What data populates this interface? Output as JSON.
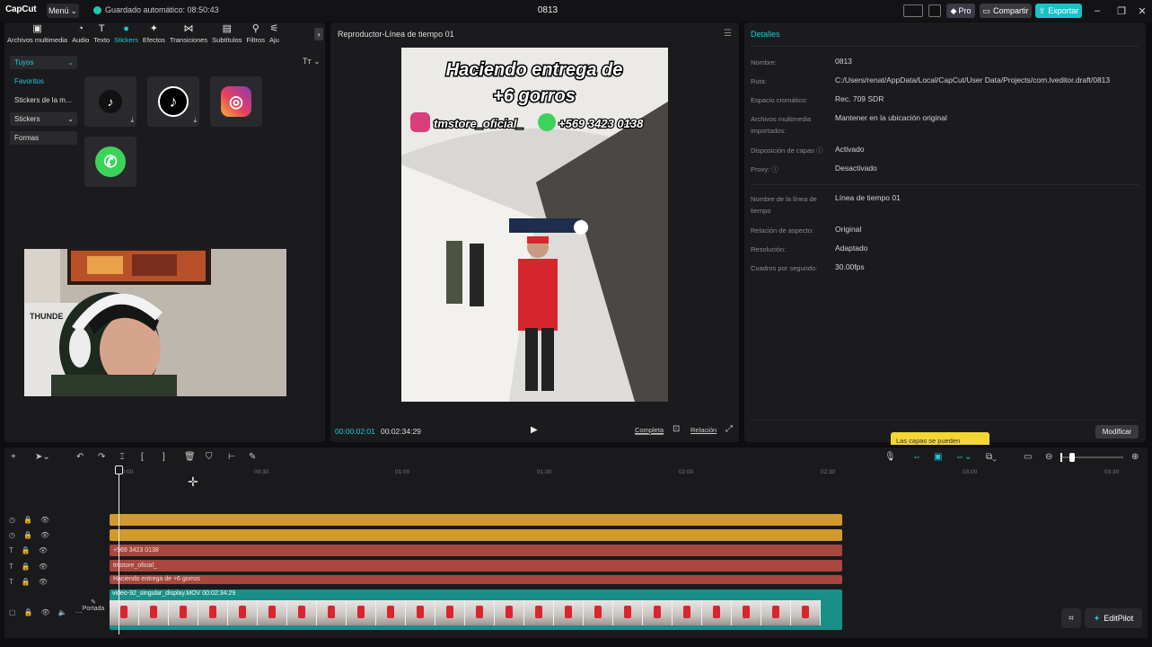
{
  "topbar": {
    "logo": "CapCut",
    "menu_label": "Menú",
    "autosave": "Guardado automático: 08:50:43",
    "project_title": "0813",
    "pro_label": "Pro",
    "share_label": "Compartir",
    "export_label": "Exportar"
  },
  "media": {
    "tabs": [
      {
        "label": "Archivos multimedia",
        "icon": "media-icon"
      },
      {
        "label": "Audio",
        "icon": "audio-icon"
      },
      {
        "label": "Texto",
        "icon": "text-icon"
      },
      {
        "label": "Stickers",
        "icon": "sticker-icon"
      },
      {
        "label": "Efectos",
        "icon": "effects-icon"
      },
      {
        "label": "Transiciones",
        "icon": "transitions-icon"
      },
      {
        "label": "Subtítulos",
        "icon": "subtitles-icon"
      },
      {
        "label": "Filtros",
        "icon": "filters-icon"
      },
      {
        "label": "Aju",
        "icon": "adjust-icon"
      }
    ],
    "nav": [
      "Tuyos",
      "Favoritos",
      "Stickers de la m...",
      "Stickers",
      "Formas"
    ],
    "filter_label": "Tт"
  },
  "player": {
    "title": "Reproductor-Línea de tiempo 01",
    "overlay_line1": "Haciendo entrega de",
    "overlay_line2": "+6 gorros",
    "overlay_ig": "tmstore_oficial_",
    "overlay_wa": "+569 3423 0138",
    "time_current": "00:00:02:01",
    "time_total": "00:02:34:29",
    "btn_complete": "Completa",
    "btn_ratio": "Relación"
  },
  "details": {
    "title": "Detalles",
    "rows": [
      {
        "label": "Nombre:",
        "value": "0813"
      },
      {
        "label": "Ruta:",
        "value": "C:/Users/renat/AppData/Local/CapCut/User Data/Projects/com.lveditor.draft/0813"
      },
      {
        "label": "Espacio cromático:",
        "value": "Rec. 709 SDR"
      },
      {
        "label": "Archivos multimedia importados:",
        "value": "Mantener en la ubicación original"
      },
      {
        "label": "Disposición de capas ⓘ",
        "value": "Activado"
      },
      {
        "label": "Proxy: ⓘ",
        "value": "Desactivado"
      },
      {
        "label": "Nombre de la línea de tiempo",
        "value": "Línea de tiempo 01"
      },
      {
        "label": "Relación de aspecto:",
        "value": "Original"
      },
      {
        "label": "Resolución:",
        "value": "Adaptado"
      },
      {
        "label": "Cuadros por segundo:",
        "value": "30.00fps"
      }
    ],
    "tooltip": "Las capas se pueden",
    "modify_label": "Modificar"
  },
  "timeline": {
    "ruler": [
      "00:00",
      "00:30",
      "01:00",
      "01:30",
      "02:00",
      "02:30",
      "03:00",
      "03:30"
    ],
    "text_clips": [
      "+569 3423 0138",
      "tmstore_oficial_",
      "Haciendo entrega de  +6 gorros"
    ],
    "video_label": "video-92_singular_display.MOV   00:02:34:29",
    "cover_label": "Portada",
    "editpilot_label": "EditPilot"
  }
}
